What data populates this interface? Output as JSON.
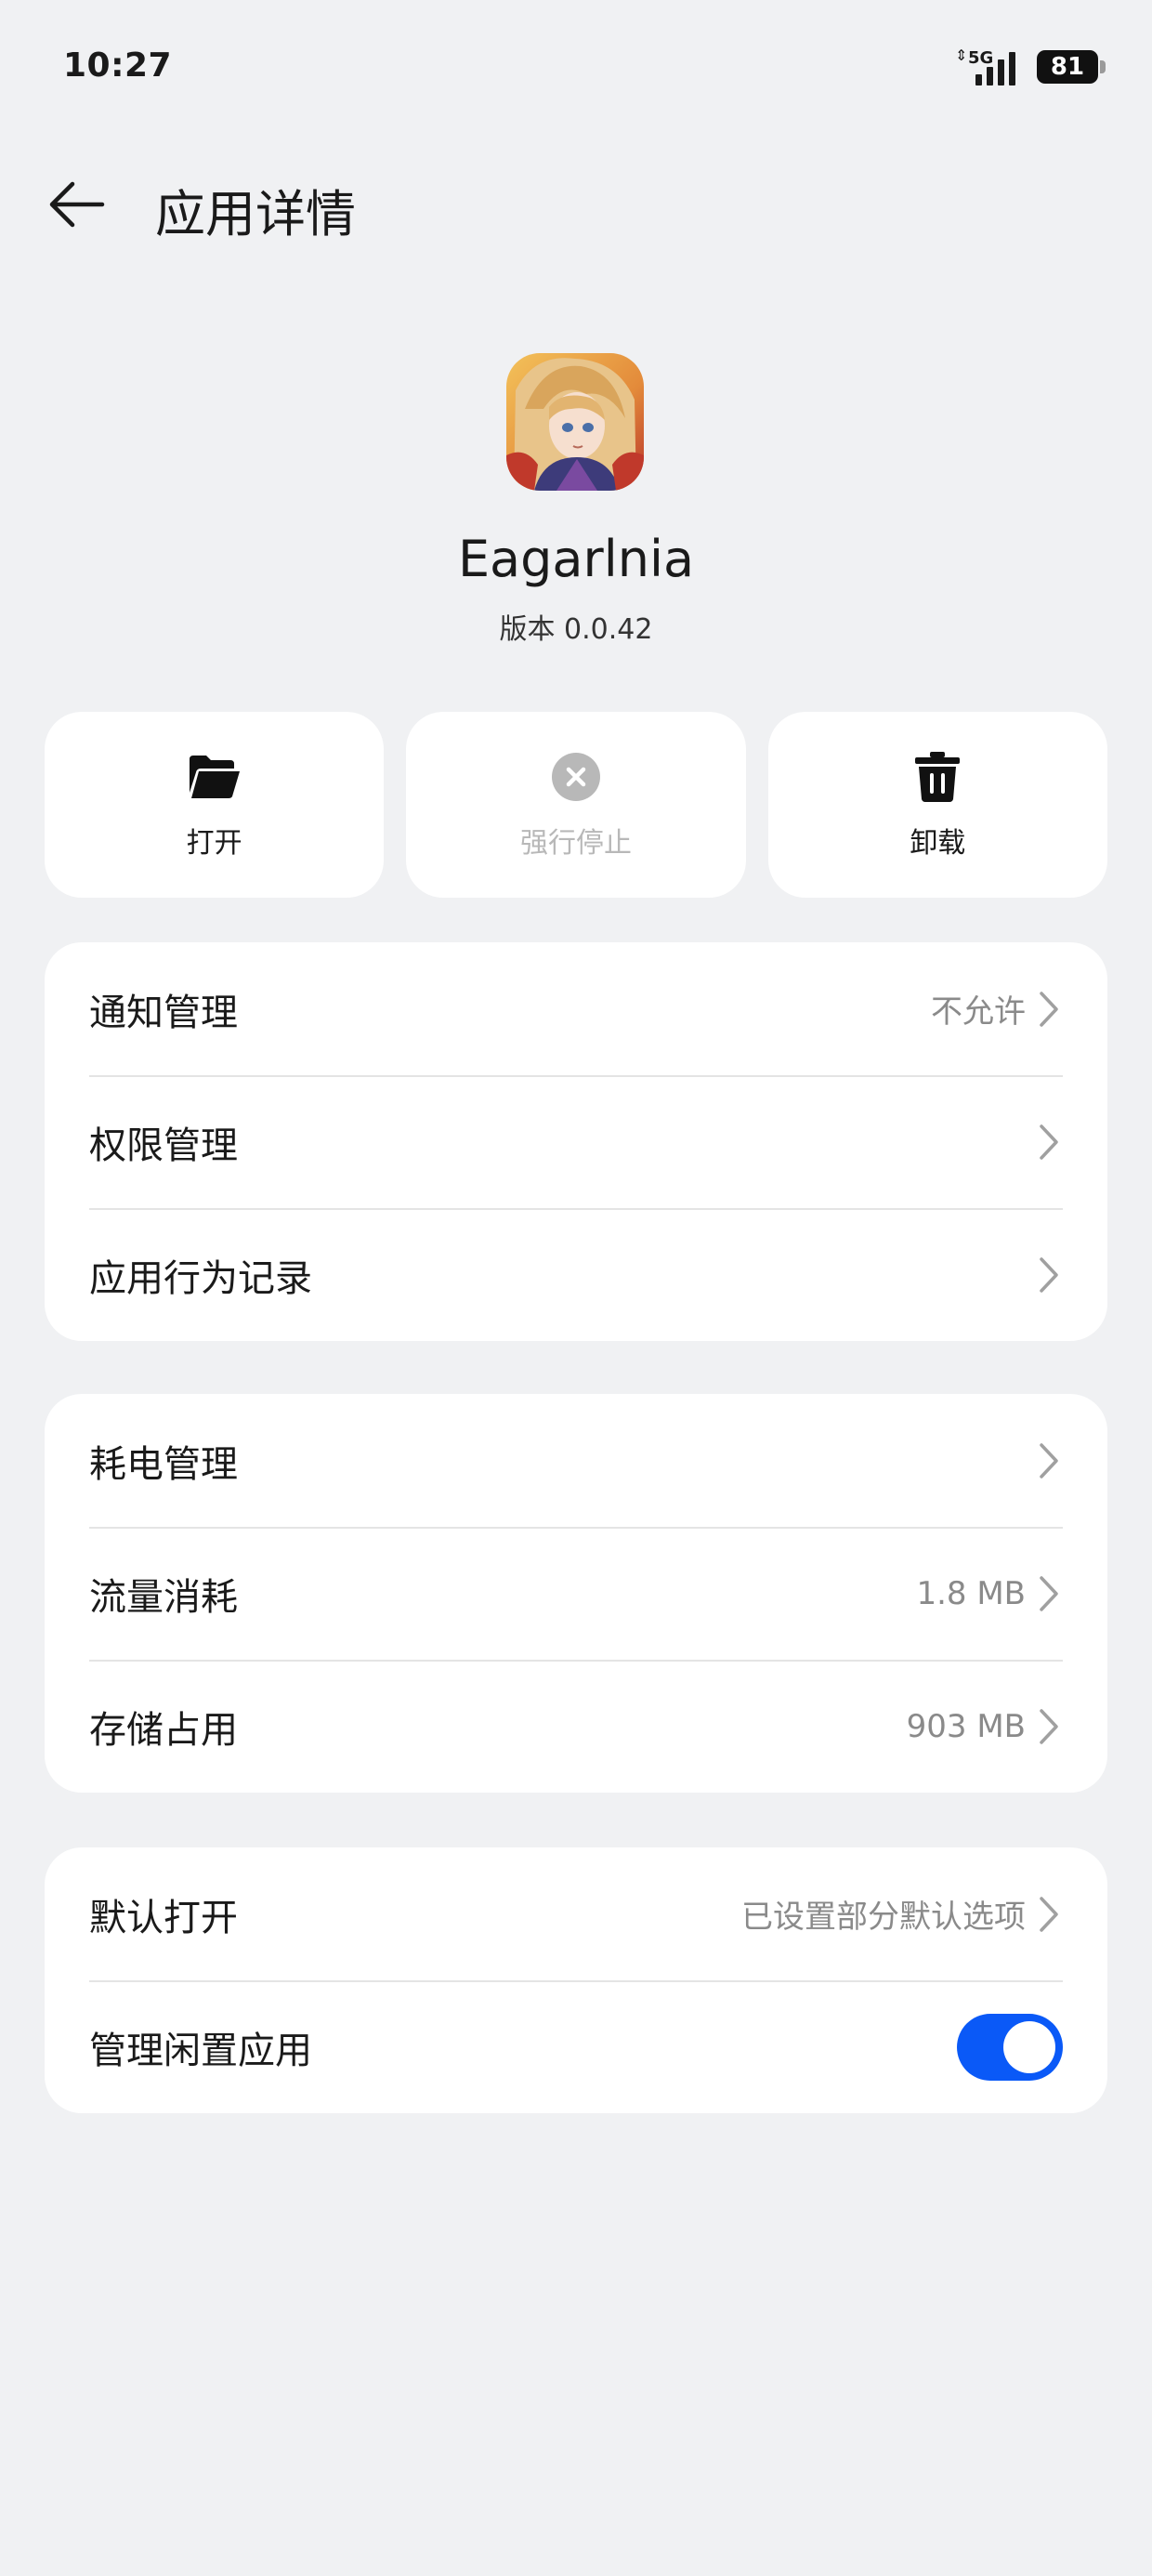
{
  "status_bar": {
    "time": "10:27",
    "network": "5G",
    "battery": "81"
  },
  "header": {
    "title": "应用详情"
  },
  "app": {
    "name": "Eagarlnia",
    "version": "版本 0.0.42"
  },
  "actions": [
    {
      "label": "打开",
      "icon": "folder-open-icon",
      "enabled": true
    },
    {
      "label": "强行停止",
      "icon": "close-circle-icon",
      "enabled": false
    },
    {
      "label": "卸载",
      "icon": "trash-icon",
      "enabled": true
    }
  ],
  "card1": {
    "rows": [
      {
        "label": "通知管理",
        "value": "不允许"
      },
      {
        "label": "权限管理",
        "value": ""
      },
      {
        "label": "应用行为记录",
        "value": ""
      }
    ]
  },
  "card2": {
    "rows": [
      {
        "label": "耗电管理",
        "value": ""
      },
      {
        "label": "流量消耗",
        "value": "1.8 MB"
      },
      {
        "label": "存储占用",
        "value": "903 MB"
      }
    ]
  },
  "card3": {
    "rows": [
      {
        "label": "默认打开",
        "value": "已设置部分默认选项"
      },
      {
        "label": "管理闲置应用",
        "toggle_on": true
      }
    ]
  },
  "colors": {
    "background": "#f0f1f3",
    "card": "#ffffff",
    "accent": "#0a59f7",
    "secondary_text": "#8a8a8a",
    "disabled_text": "#b8b8b8"
  }
}
